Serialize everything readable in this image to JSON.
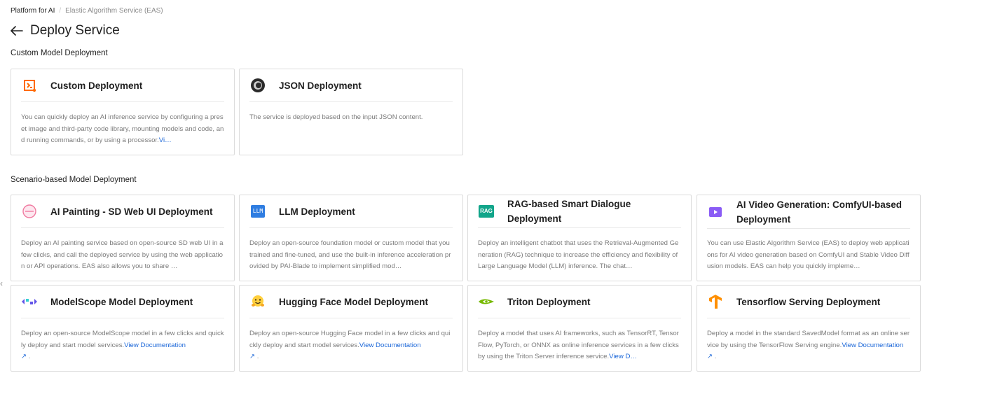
{
  "breadcrumb": {
    "root": "Platform for AI",
    "separator": "/",
    "current": "Elastic Algorithm Service (EAS)"
  },
  "page": {
    "title": "Deploy Service"
  },
  "sections": {
    "custom": "Custom Model Deployment",
    "scenario": "Scenario-based Model Deployment"
  },
  "cards": {
    "custom": {
      "title": "Custom Deployment",
      "desc": "You can quickly deploy an AI inference service by configuring a preset image and third-party code library, mounting models and code, and running commands, or by using a processor.",
      "link": "Vi…",
      "icon": "custom-deploy-icon"
    },
    "json": {
      "title": "JSON Deployment",
      "desc": "The service is deployed based on the input JSON content.",
      "icon": "json-icon"
    },
    "ai_painting": {
      "title": "AI Painting - SD Web UI Deployment",
      "desc": "Deploy an AI painting service based on open-source SD web UI in a few clicks, and call the deployed service by using the web application or API operations. EAS also allows you to share …",
      "icon": "palette-icon"
    },
    "llm": {
      "title": "LLM Deployment",
      "desc": "Deploy an open-source foundation model or custom model that you trained and fine-tuned, and use the built-in inference acceleration provided by PAI-Blade to implement simplified mod…",
      "icon": "llm-icon",
      "badge": "LLM"
    },
    "rag": {
      "title": "RAG-based Smart Dialogue Deployment",
      "desc": "Deploy an intelligent chatbot that uses the Retrieval-Augmented Generation (RAG) technique to increase the efficiency and flexibility of Large Language Model (LLM) inference. The chat…",
      "icon": "rag-icon",
      "badge": "RAG"
    },
    "video": {
      "title": "AI Video Generation: ComfyUI-based Deployment",
      "desc": "You can use Elastic Algorithm Service (EAS) to deploy web applications for AI video generation based on ComfyUI and Stable Video Diffusion models. EAS can help you quickly impleme…",
      "icon": "video-icon"
    },
    "modelscope": {
      "title": "ModelScope Model Deployment",
      "desc": "Deploy an open-source ModelScope model in a few clicks and quickly deploy and start model services.",
      "link": "View Documentation",
      "tail": ".",
      "icon": "modelscope-icon"
    },
    "huggingface": {
      "title": "Hugging Face Model Deployment",
      "desc": "Deploy an open-source Hugging Face model in a few clicks and quickly deploy and start model services.",
      "link": "View Documentation",
      "tail": ".",
      "icon": "hugging-face-icon"
    },
    "triton": {
      "title": "Triton Deployment",
      "desc": "Deploy a model that uses AI frameworks, such as TensorRT, TensorFlow, PyTorch, or ONNX as online inference services in a few clicks by using the Triton Server inference service.",
      "link": "View D…",
      "icon": "nvidia-icon"
    },
    "tensorflow": {
      "title": "Tensorflow Serving Deployment",
      "desc": "Deploy a model in the standard SavedModel format as an online service by using the TensorFlow Serving engine.",
      "link": "View Documentation",
      "tail": ".",
      "icon": "tensorflow-icon"
    }
  },
  "colors": {
    "link": "#1a66d8",
    "border": "#dcdcdc",
    "text_muted": "#7a7a7a"
  }
}
